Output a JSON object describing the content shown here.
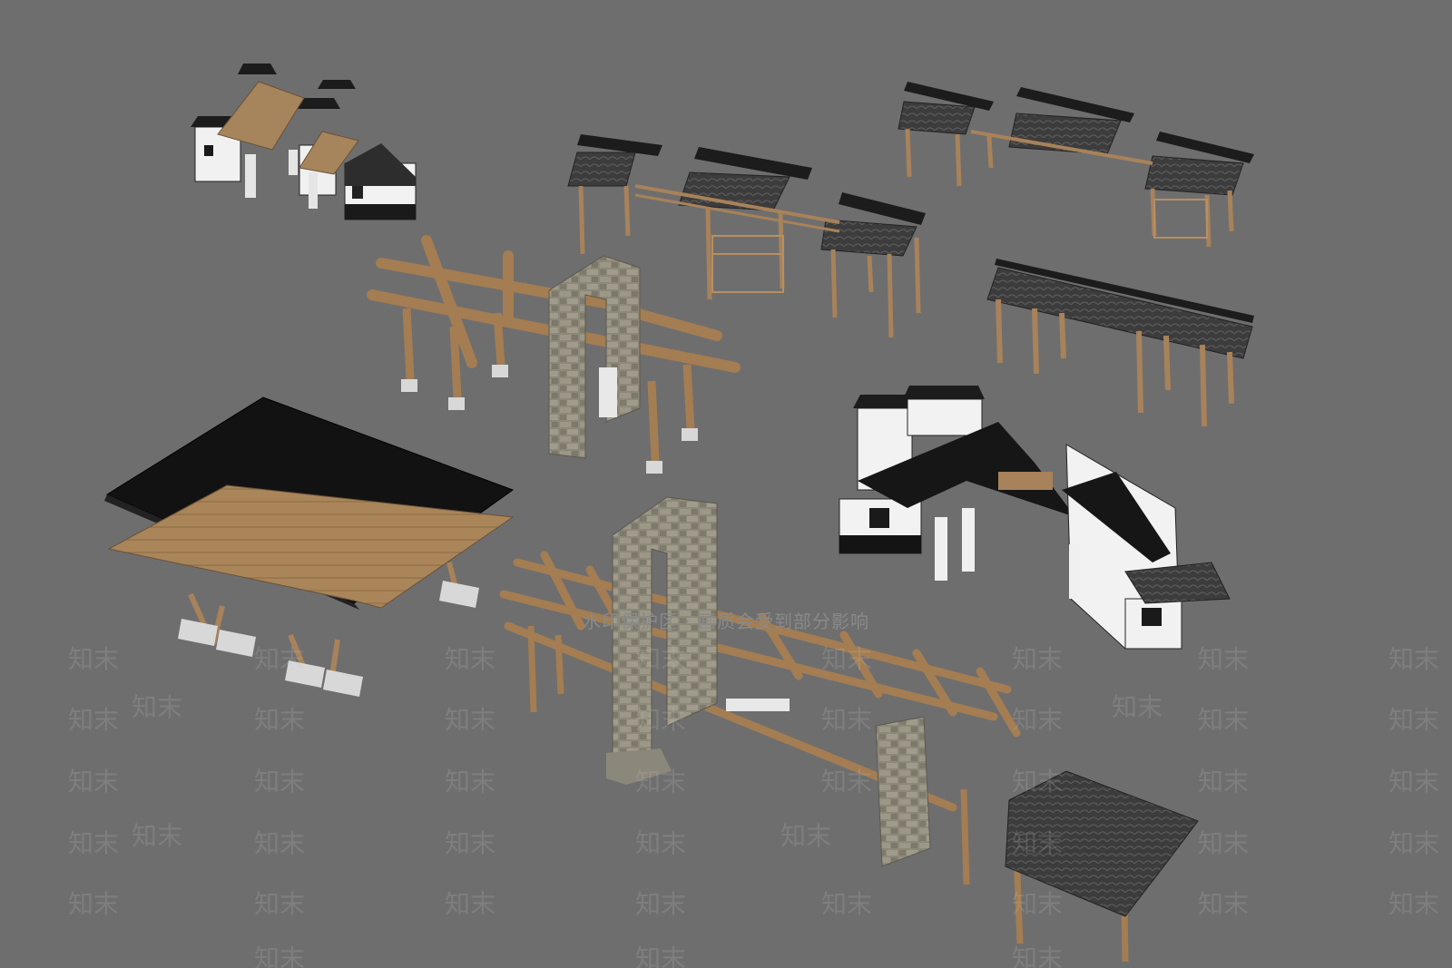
{
  "scene": {
    "background": "#6e6e6e",
    "wood_color": "#a8825a",
    "tile_color": "#3a3a3a",
    "wall_color": "#f2f2f2",
    "stone_color": "#8e8a7a",
    "roof_dark": "#141414"
  },
  "watermark": {
    "notice": "水印保护区 · 画质会受到部分影响",
    "mark": "知末"
  }
}
